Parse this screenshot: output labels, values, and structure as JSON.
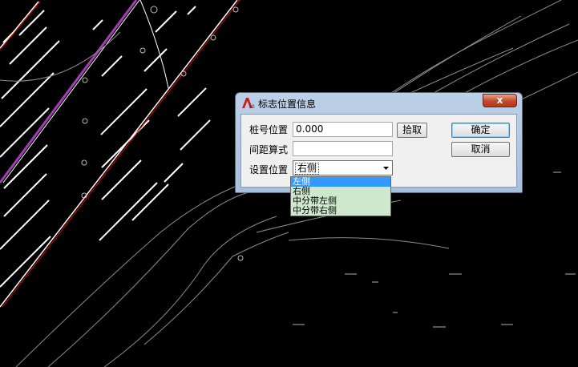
{
  "dialog": {
    "title": "标志位置信息",
    "close_label": "x",
    "station_label": "桩号位置",
    "station_value": "0.000",
    "pick_button": "拾取",
    "spacing_label": "间距算式",
    "spacing_value": "",
    "position_label": "设置位置",
    "position_value": "右侧",
    "ok_button": "确定",
    "cancel_button": "取消"
  },
  "dropdown": {
    "options": [
      "左侧",
      "右侧",
      "中分带左侧",
      "中分带右侧"
    ],
    "highlighted_index": 0
  },
  "colors": {
    "background": "#000000",
    "road_lines": "#ffffff",
    "road_edge_red": "#e00000",
    "centerline_purple": "#a040b0",
    "dropdown_bg": "#cde8cd",
    "highlight": "#3399ff"
  }
}
